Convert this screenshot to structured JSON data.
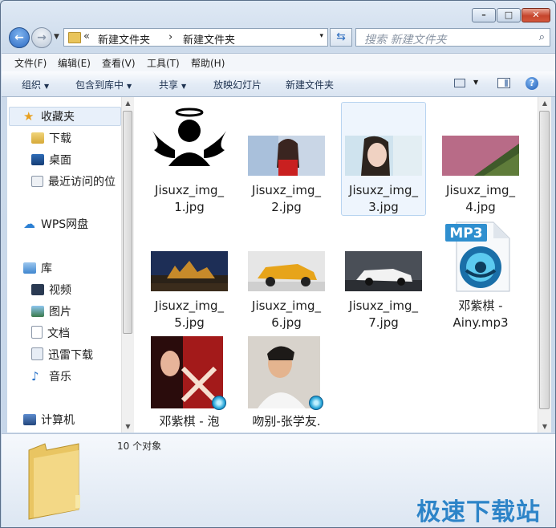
{
  "window": {
    "controls": {
      "minimize": "–",
      "maximize": "□",
      "close": "✕"
    }
  },
  "address_bar": {
    "chevron": "«",
    "segments": [
      "新建文件夹",
      "新建文件夹"
    ],
    "separator": "›",
    "dropdown": "▾"
  },
  "search": {
    "placeholder": "搜索 新建文件夹"
  },
  "menu": [
    "文件(F)",
    "编辑(E)",
    "查看(V)",
    "工具(T)",
    "帮助(H)"
  ],
  "toolbar": {
    "organize": "组织",
    "include_in_library": "包含到库中",
    "share": "共享",
    "slideshow": "放映幻灯片",
    "new_folder": "新建文件夹"
  },
  "sidebar": {
    "favorites": "收藏夹",
    "favorites_items": [
      "下载",
      "桌面",
      "最近访问的位"
    ],
    "wps": "WPS网盘",
    "library": "库",
    "library_items": [
      "视频",
      "图片",
      "文档",
      "迅雷下载",
      "音乐"
    ],
    "computer": "计算机"
  },
  "files": [
    {
      "line1": "Jisuxz_img_",
      "line2": "1.jpg"
    },
    {
      "line1": "Jisuxz_img_",
      "line2": "2.jpg"
    },
    {
      "line1": "Jisuxz_img_",
      "line2": "3.jpg"
    },
    {
      "line1": "Jisuxz_img_",
      "line2": "4.jpg"
    },
    {
      "line1": "Jisuxz_img_",
      "line2": "5.jpg"
    },
    {
      "line1": "Jisuxz_img_",
      "line2": "6.jpg"
    },
    {
      "line1": "Jisuxz_img_",
      "line2": "7.jpg"
    },
    {
      "line1": "邓紫棋 -",
      "line2": "Ainy.mp3",
      "icon_text": "MP3"
    },
    {
      "line1": "邓紫棋 - 泡",
      "line2": ""
    },
    {
      "line1": "吻别-张学友.",
      "line2": ""
    }
  ],
  "status": {
    "count": "10 个对象"
  },
  "watermark": "极速下载站",
  "colors": {
    "accent": "#2d84c8",
    "selection": "#eef5fd"
  }
}
